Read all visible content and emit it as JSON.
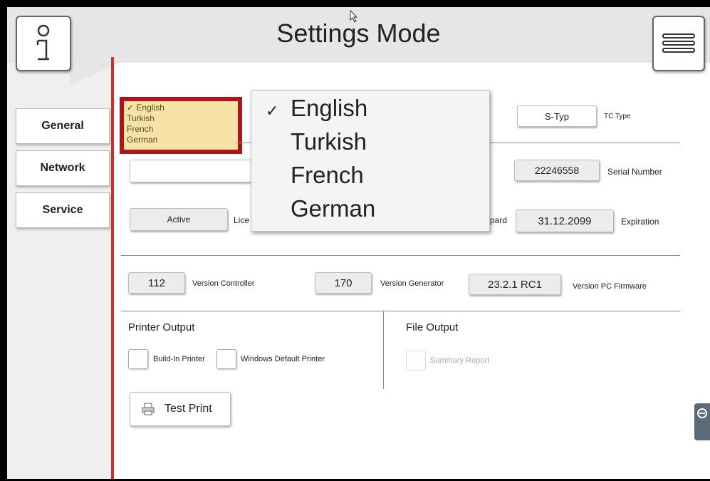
{
  "header": {
    "title": "Settings Mode"
  },
  "sidebar": {
    "items": [
      {
        "label": "General"
      },
      {
        "label": "Network"
      },
      {
        "label": "Service"
      }
    ]
  },
  "language": {
    "selector_options": [
      "✓ English",
      "Turkish",
      "French",
      "German"
    ],
    "dropdown": {
      "selected": "English",
      "options": [
        "English",
        "Turkish",
        "French",
        "German"
      ]
    }
  },
  "tc_type": {
    "value": "S-Typ",
    "label": "TC Type"
  },
  "serial": {
    "value": "22246558",
    "label": "Serial Number"
  },
  "license": {
    "status": "Active",
    "label_partial": "Lice",
    "board_partial": "pard"
  },
  "expiration": {
    "value": "31.12.2099",
    "label": "Expiration"
  },
  "versions": {
    "controller": {
      "value": "112",
      "label": "Version Controller"
    },
    "generator": {
      "value": "170",
      "label": "Version Generator"
    },
    "firmware": {
      "value": "23.2.1 RC1",
      "label": "Version PC Firmware"
    }
  },
  "printer_output": {
    "title": "Printer Output",
    "build_in": "Build-In Printer",
    "windows_default": "Windows Default Printer",
    "test_print": "Test Print"
  },
  "file_output": {
    "title": "File Output",
    "summary_report": "Summary Report"
  },
  "icons": [
    "info-icon",
    "hamburger-menu-icon",
    "check-icon",
    "printer-icon",
    "cursor-icon",
    "remote-tab-icon"
  ],
  "colors": {
    "accent_red": "#d62b2b",
    "highlight_border": "#b0141a",
    "highlight_fill": "#f7e3a7"
  }
}
